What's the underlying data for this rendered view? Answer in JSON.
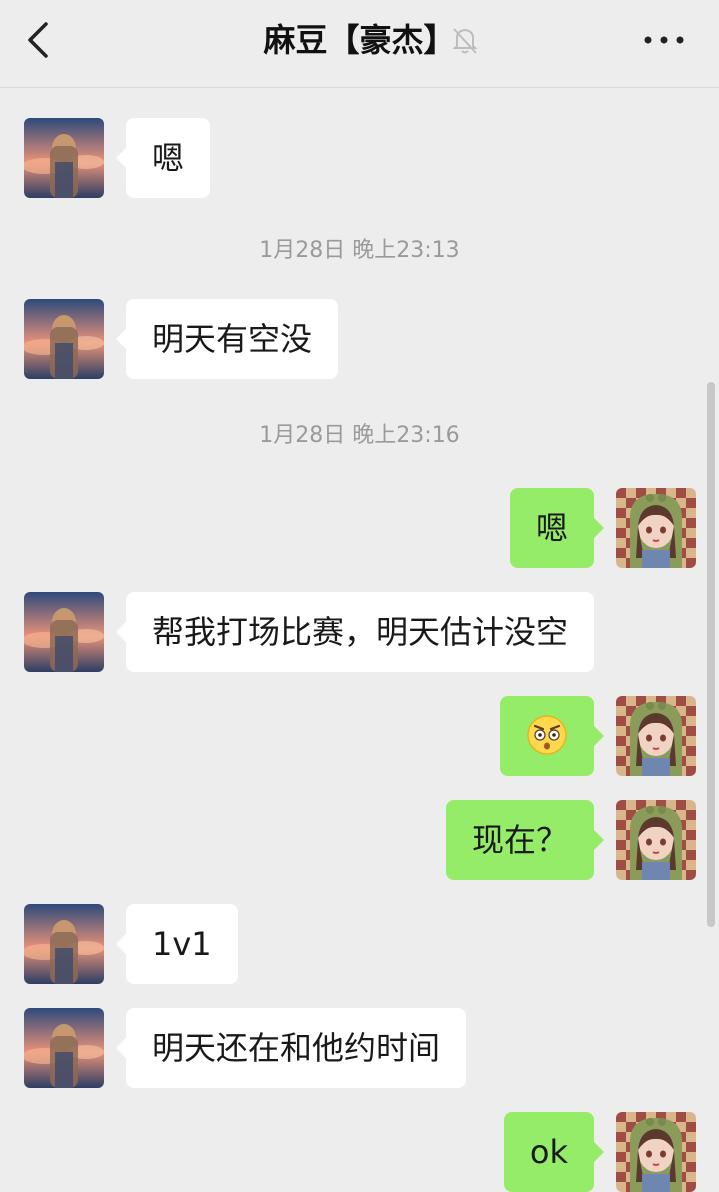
{
  "header": {
    "title": "麻豆【豪杰】",
    "back_icon": "chevron-left-icon",
    "mute_icon": "bell-off-icon",
    "more_icon": "more-dots-icon"
  },
  "messages": [
    {
      "type": "text",
      "side": "left",
      "text": "嗯"
    },
    {
      "type": "time",
      "text": "1月28日 晚上23:13"
    },
    {
      "type": "text",
      "side": "left",
      "text": "明天有空没"
    },
    {
      "type": "time",
      "text": "1月28日 晚上23:16"
    },
    {
      "type": "text",
      "side": "right",
      "text": "嗯"
    },
    {
      "type": "text",
      "side": "left",
      "text": "帮我打场比赛，明天估计没空"
    },
    {
      "type": "emoji",
      "side": "right",
      "icon": "flushed-face-emoji"
    },
    {
      "type": "text",
      "side": "right",
      "text": "现在？"
    },
    {
      "type": "text",
      "side": "left",
      "text": "1v1"
    },
    {
      "type": "text",
      "side": "left",
      "text": "明天还在和他约时间"
    },
    {
      "type": "text",
      "side": "right",
      "text": "ok"
    }
  ],
  "colors": {
    "background": "#ededed",
    "self_bubble": "#95ec69",
    "other_bubble": "#ffffff",
    "timestamp": "#9a9a9a"
  }
}
